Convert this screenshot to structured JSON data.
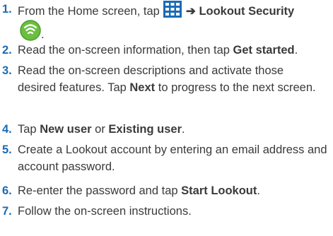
{
  "steps": [
    {
      "num": "1.",
      "a": "From the Home screen, tap ",
      "arrow": "➔",
      "b": "Lookout Security",
      "c": "."
    },
    {
      "num": "2.",
      "a": "Read the on-screen information, then tap ",
      "b": "Get started",
      "c": "."
    },
    {
      "num": "3.",
      "a": "Read the on-screen descriptions and activate those desired features. Tap ",
      "b": "Next",
      "c": " to progress to the next screen."
    },
    {
      "num": "4.",
      "a": "Tap ",
      "b": "New user",
      "c": " or ",
      "d": "Existing user",
      "e": "."
    },
    {
      "num": "5.",
      "a": "Create a Lookout account by entering an email address and account password."
    },
    {
      "num": "6.",
      "a": "Re-enter the password and tap ",
      "b": "Start Lookout",
      "c": "."
    },
    {
      "num": "7.",
      "a": "Follow the on-screen instructions."
    }
  ],
  "icons": {
    "apps": "apps-grid-icon",
    "app": "lookout-shield-icon"
  },
  "colors": {
    "number": "#1a6bb5",
    "text": "#3a3a3a",
    "apps_icon": "#1a6bb5",
    "shield": "#6abf3f"
  }
}
